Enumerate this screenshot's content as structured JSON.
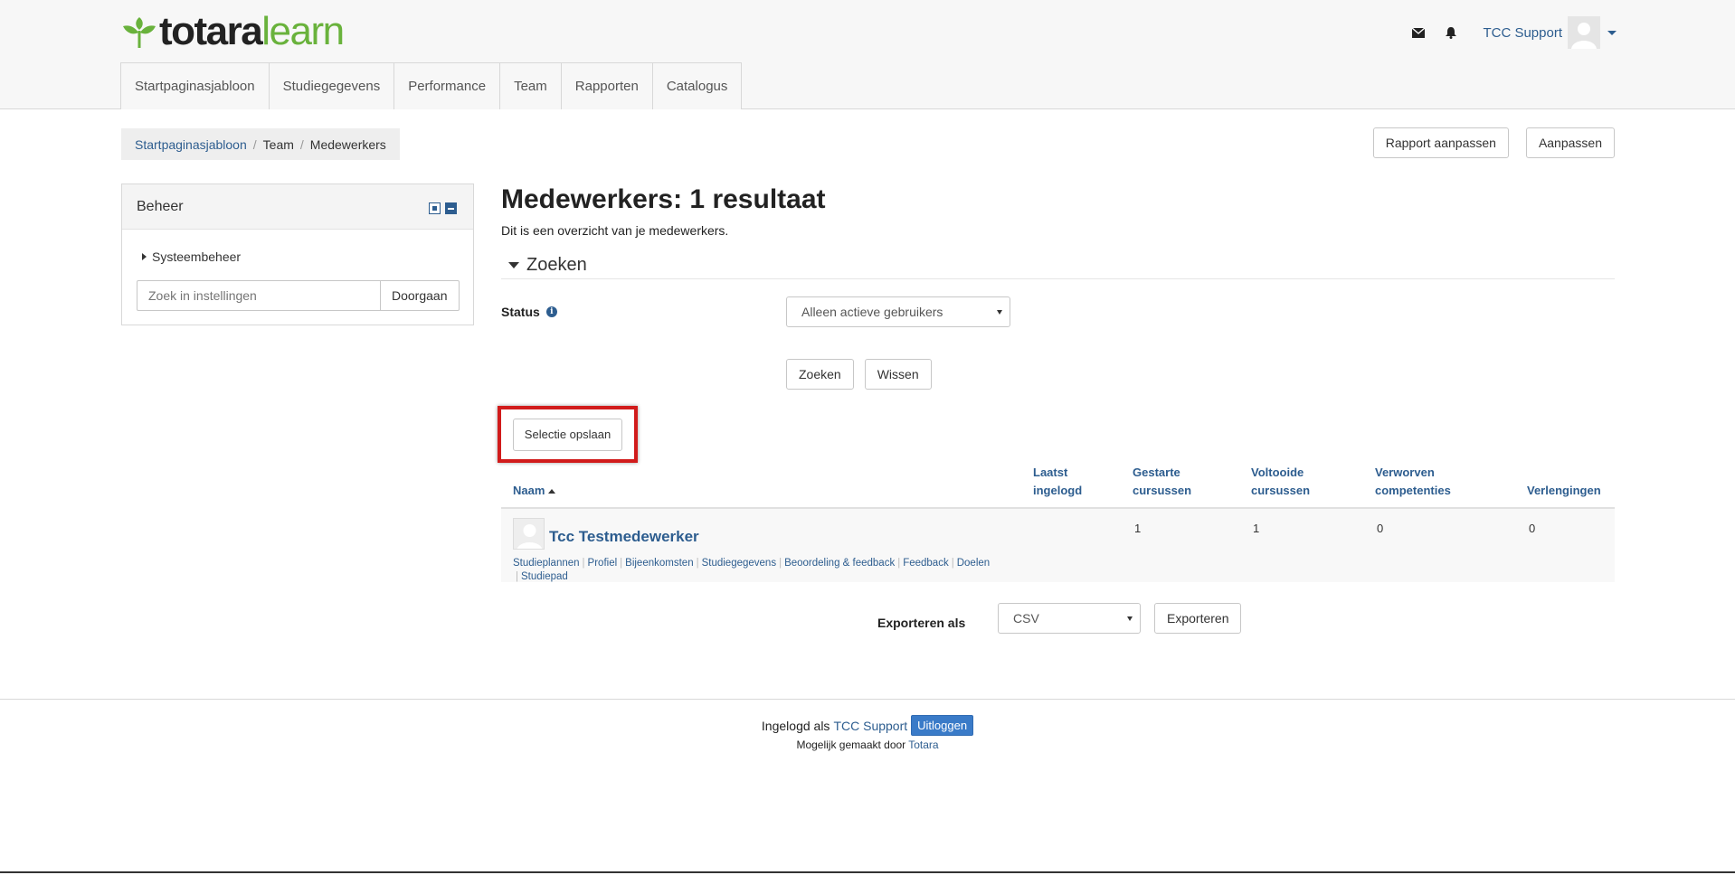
{
  "header": {
    "logo_part1": "totara",
    "logo_part2": "learn",
    "user_name": "TCC Support",
    "icons": {
      "messages": "envelope-icon",
      "notifications": "bell-icon"
    }
  },
  "nav": {
    "items": [
      "Startpaginasjabloon",
      "Studiegegevens",
      "Performance",
      "Team",
      "Rapporten",
      "Catalogus"
    ]
  },
  "breadcrumb": {
    "items": [
      "Startpaginasjabloon",
      "Team",
      "Medewerkers"
    ],
    "separator": "/"
  },
  "toolbar": {
    "edit_report": "Rapport aanpassen",
    "customize": "Aanpassen"
  },
  "block": {
    "title": "Beheer",
    "tree_item": "Systeembeheer",
    "search_placeholder": "Zoek in instellingen",
    "go_button": "Doorgaan"
  },
  "main": {
    "title": "Medewerkers: 1 resultaat",
    "description": "Dit is een overzicht van je medewerkers.",
    "search_legend": "Zoeken",
    "status_label": "Status",
    "status_value": "Alleen actieve gebruikers",
    "search_button": "Zoeken",
    "clear_button": "Wissen",
    "save_selection_button": "Selectie opslaan"
  },
  "table": {
    "headers": {
      "name": "Naam",
      "last_login": "Laatst ingelogd",
      "started": "Gestarte cursussen",
      "completed": "Voltooide cursussen",
      "competencies": "Verworven competenties",
      "extensions": "Verlengingen"
    },
    "rows": [
      {
        "name": "Tcc Testmedewerker",
        "last_login": "",
        "started": "1",
        "completed": "1",
        "competencies": "0",
        "extensions": "0",
        "links": [
          "Studieplannen",
          "Profiel",
          "Bijeenkomsten",
          "Studiegegevens",
          "Beoordeling & feedback",
          "Feedback",
          "Doelen",
          "Studiepad"
        ]
      }
    ]
  },
  "export": {
    "label": "Exporteren als",
    "format": "CSV",
    "button": "Exporteren"
  },
  "footer": {
    "logged_in_as": "Ingelogd als",
    "user": "TCC Support",
    "logout": "Uitloggen",
    "powered_by": "Mogelijk gemaakt door",
    "powered_link": "Totara"
  },
  "colors": {
    "brand_green": "#69b23c",
    "link_blue": "#2d5d8f",
    "highlight_red": "#d11b1b",
    "logout_blue": "#3a7bc8"
  }
}
